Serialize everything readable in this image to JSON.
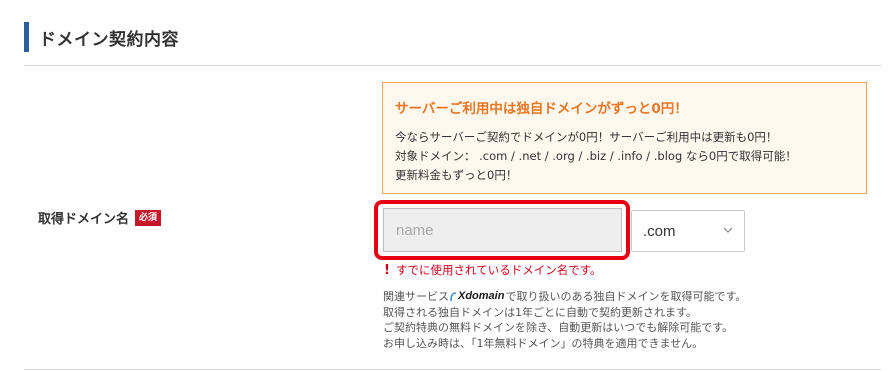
{
  "section": {
    "title": "ドメイン契約内容"
  },
  "promo": {
    "title": "サーバーご利用中は独自ドメインがずっと0円！",
    "lines": [
      "今ならサーバーご契約でドメインが0円！サーバーご利用中は更新も0円！",
      "対象ドメイン： .com / .net / .org / .biz / .info / .blog なら0円で取得可能！",
      "更新料金もずっと0円！"
    ]
  },
  "field": {
    "label": "取得ドメイン名",
    "required_badge": "必須",
    "name_placeholder": "name",
    "name_value": "",
    "tld_selected": ".com",
    "error_icon": "!",
    "error_message": "すでに使用されているドメイン名です。"
  },
  "notes": {
    "line1_prefix": "関連サービス",
    "logo_text": "Xdomain",
    "line1_suffix": "で取り扱いのある独自ドメインを取得可能です。",
    "line2": "取得される独自ドメインは1年ごとに自動で契約更新されます。",
    "line3": "ご契約特典の無料ドメインを除き、自動更新はいつでも解除可能です。",
    "line4": "お申し込み時は、「1年無料ドメイン」の特典を適用できません。"
  },
  "colors": {
    "accent_bar": "#2b5d9e",
    "promo_title": "#e87624",
    "promo_border": "#f2a65a",
    "error": "#d0021b",
    "highlight": "#e60012",
    "required_badge": "#c7172a"
  },
  "icons": {
    "chevron": "chevron-down-icon",
    "warning": "warning-icon",
    "logo": "xdomain-logo"
  }
}
